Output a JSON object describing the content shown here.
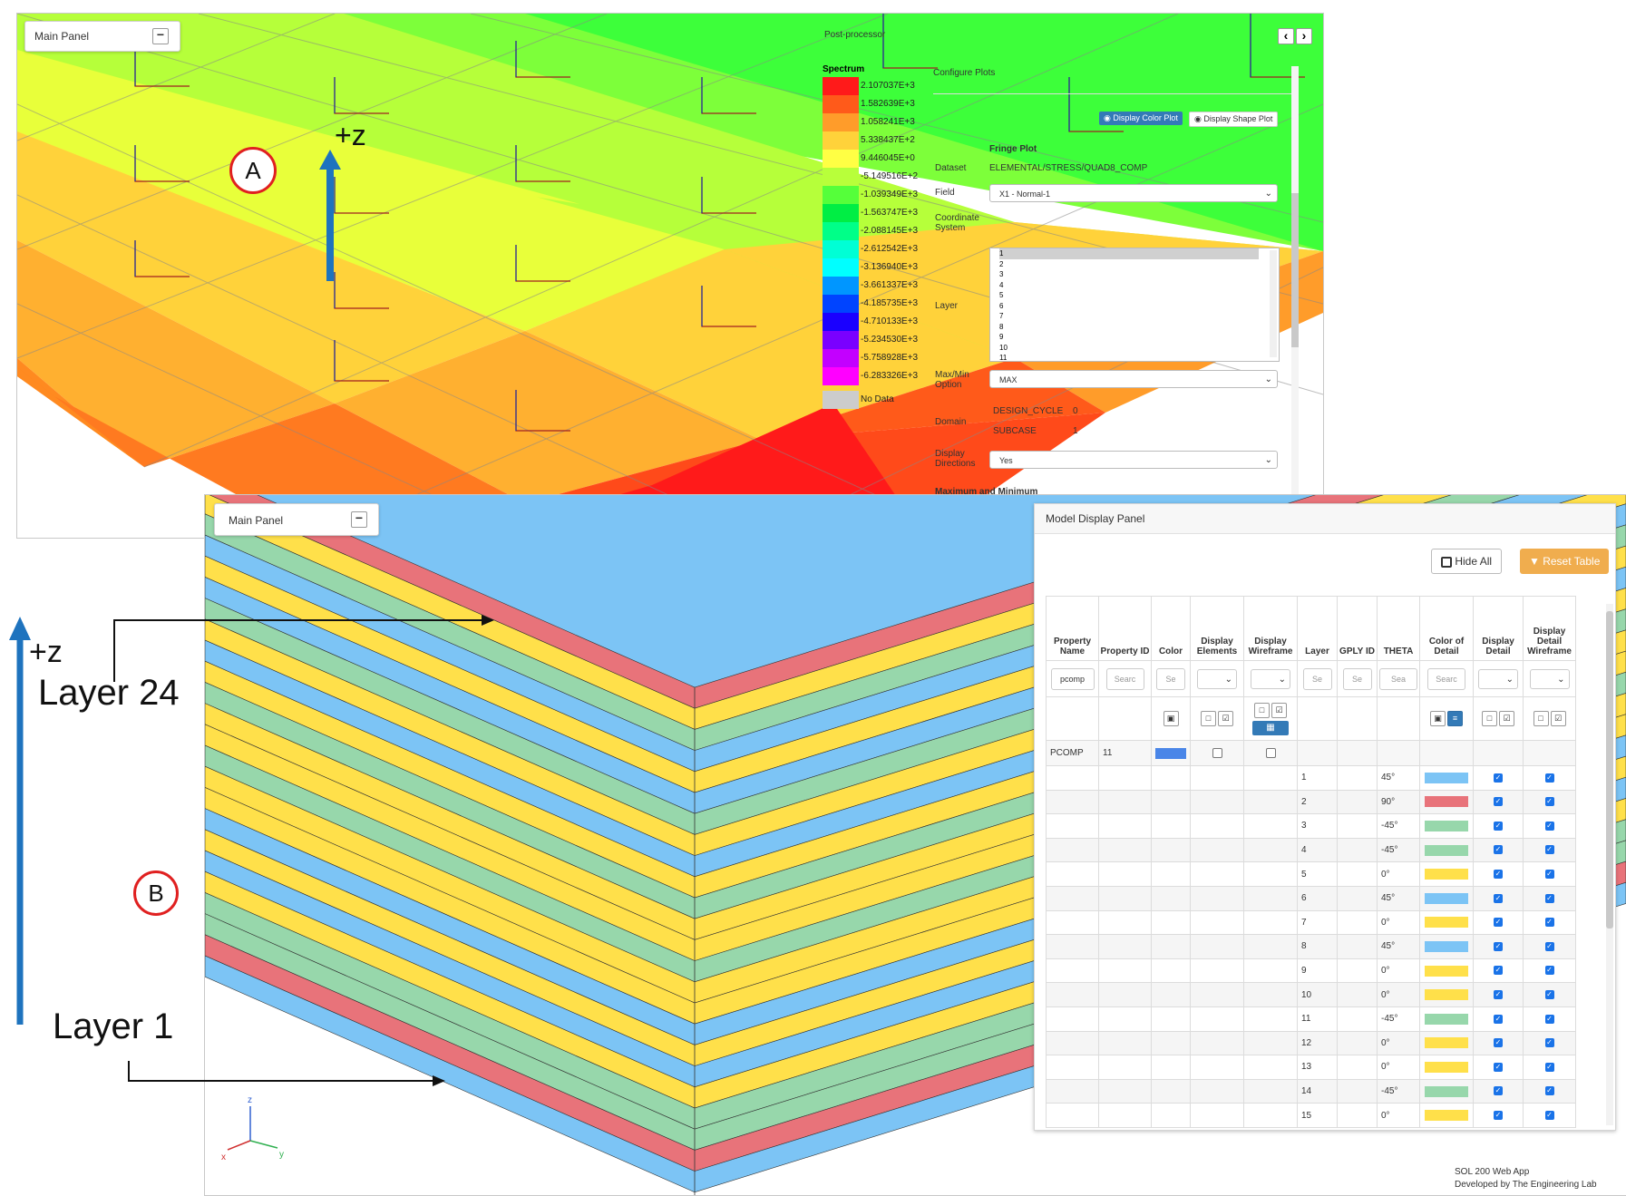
{
  "shotA": {
    "main_panel": {
      "label": "Main Panel",
      "collapse": "−"
    },
    "postprocessor": "Post-processor",
    "axis_label": "+z",
    "marker": "A",
    "nav": {
      "prev": "‹",
      "next": "›"
    },
    "configure_plots": "Configure Plots",
    "btn_color_plot": "Display Color Plot",
    "btn_shape_plot": "Display Shape Plot",
    "spectrum_title": "Spectrum",
    "spectrum": [
      {
        "label": "2.107037E+3",
        "color": "#ff1a1a"
      },
      {
        "label": "1.582639E+3",
        "color": "#ff5a1a"
      },
      {
        "label": "1.058241E+3",
        "color": "#ff9c2a"
      },
      {
        "label": "5.338437E+2",
        "color": "#ffd23a"
      },
      {
        "label": "9.446045E+0",
        "color": "#ffff44"
      },
      {
        "label": "-5.149516E+2",
        "color": "#b8ff3a"
      },
      {
        "label": "-1.039349E+3",
        "color": "#55ff3a"
      },
      {
        "label": "-1.563747E+3",
        "color": "#00ee44"
      },
      {
        "label": "-2.088145E+3",
        "color": "#00ff88"
      },
      {
        "label": "-2.612542E+3",
        "color": "#00ffd5"
      },
      {
        "label": "-3.136940E+3",
        "color": "#00ffff"
      },
      {
        "label": "-3.661337E+3",
        "color": "#0096ff"
      },
      {
        "label": "-4.185735E+3",
        "color": "#0044ff"
      },
      {
        "label": "-4.710133E+3",
        "color": "#1a00ff"
      },
      {
        "label": "-5.234530E+3",
        "color": "#7a00ff"
      },
      {
        "label": "-5.758928E+3",
        "color": "#c300ff"
      },
      {
        "label": "-6.283326E+3",
        "color": "#ff00ff"
      }
    ],
    "no_data": "No Data",
    "fringe": {
      "title": "Fringe Plot",
      "dataset_label": "Dataset",
      "dataset_value": "ELEMENTAL/STRESS/QUAD8_COMP",
      "field_label": "Field",
      "field_value": "X1 - Normal-1",
      "coord_label": "Coordinate System",
      "layer_label": "Layer",
      "layers": [
        "1",
        "2",
        "3",
        "4",
        "5",
        "6",
        "7",
        "8",
        "9",
        "10",
        "11"
      ],
      "maxmin_label": "Max/Min Option",
      "maxmin_value": "MAX",
      "domain_label": "Domain",
      "design_cycle_label": "DESIGN_CYCLE",
      "design_cycle_value": "0",
      "subcase_label": "SUBCASE",
      "subcase_value": "1",
      "directions_label": "Display Directions",
      "directions_value": "Yes",
      "maxmin_heading": "Maximum and Minimum"
    }
  },
  "shotB": {
    "main_panel": {
      "label": "Main Panel",
      "collapse": "−"
    },
    "marker": "B",
    "axis_label": "+z",
    "layer_top": "Layer 24",
    "layer_bottom": "Layer 1",
    "triad": {
      "z": "z",
      "x": "x",
      "y": "y"
    },
    "footer_line1": "SOL 200 Web App",
    "footer_line2": "Developed by The Engineering Lab",
    "panel": {
      "title": "Model Display Panel",
      "hide_all": "Hide All",
      "reset_table": "Reset Table",
      "columns": [
        "Property Name",
        "Property ID",
        "Color",
        "Display Elements",
        "Display Wireframe",
        "Layer",
        "GPLY ID",
        "THETA",
        "Color of Detail",
        "Display Detail",
        "Display Detail Wireframe"
      ],
      "search": [
        "pcomp",
        "Searc",
        "Se",
        "",
        "",
        "Se",
        "Se",
        "Sea",
        "Searc",
        "",
        ""
      ],
      "pcomp_row": {
        "name": "PCOMP",
        "id": "11"
      },
      "plies": [
        {
          "layer": "1",
          "theta": "45°",
          "color": "#7cc4f5"
        },
        {
          "layer": "2",
          "theta": "90°",
          "color": "#e8737a"
        },
        {
          "layer": "3",
          "theta": "-45°",
          "color": "#97d7ab"
        },
        {
          "layer": "4",
          "theta": "-45°",
          "color": "#97d7ab"
        },
        {
          "layer": "5",
          "theta": "0°",
          "color": "#ffe04a"
        },
        {
          "layer": "6",
          "theta": "45°",
          "color": "#7cc4f5"
        },
        {
          "layer": "7",
          "theta": "0°",
          "color": "#ffe04a"
        },
        {
          "layer": "8",
          "theta": "45°",
          "color": "#7cc4f5"
        },
        {
          "layer": "9",
          "theta": "0°",
          "color": "#ffe04a"
        },
        {
          "layer": "10",
          "theta": "0°",
          "color": "#ffe04a"
        },
        {
          "layer": "11",
          "theta": "-45°",
          "color": "#97d7ab"
        },
        {
          "layer": "12",
          "theta": "0°",
          "color": "#ffe04a"
        },
        {
          "layer": "13",
          "theta": "0°",
          "color": "#ffe04a"
        },
        {
          "layer": "14",
          "theta": "-45°",
          "color": "#97d7ab"
        },
        {
          "layer": "15",
          "theta": "0°",
          "color": "#ffe04a"
        }
      ]
    }
  },
  "colors": {
    "accent_blue": "#1e73be",
    "reset_orange": "#f0ad4e",
    "circle_red": "#e02020"
  }
}
